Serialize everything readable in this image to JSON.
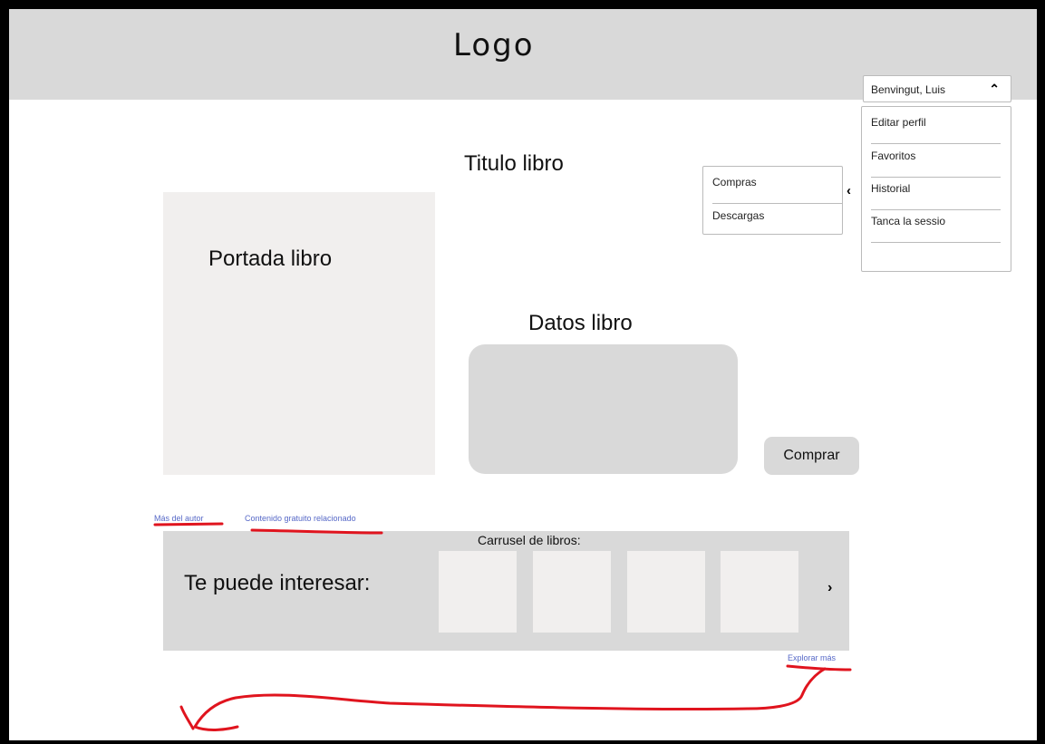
{
  "header": {
    "logo": "Logo"
  },
  "user_menu": {
    "name": "Benvingut, Luis",
    "items": [
      "Editar perfil",
      "Favoritos",
      "Historial",
      "Tanca la sessio"
    ]
  },
  "submenu": {
    "items": [
      "Compras",
      "Descargas"
    ]
  },
  "book": {
    "title": "Titulo libro",
    "cover_label": "Portada libro",
    "data_label": "Datos libro",
    "buy_label": "Comprar"
  },
  "links": {
    "author": "Más del autor",
    "related": "Contenido gratuito relacionado",
    "explore": "Explorar más"
  },
  "carousel": {
    "caption": "Carrusel de libros:",
    "heading": "Te puede interesar:"
  },
  "colors": {
    "annotation": "#e0141e",
    "link": "#5668c7",
    "panel": "#d9d9d9",
    "placeholder": "#f1efee"
  }
}
